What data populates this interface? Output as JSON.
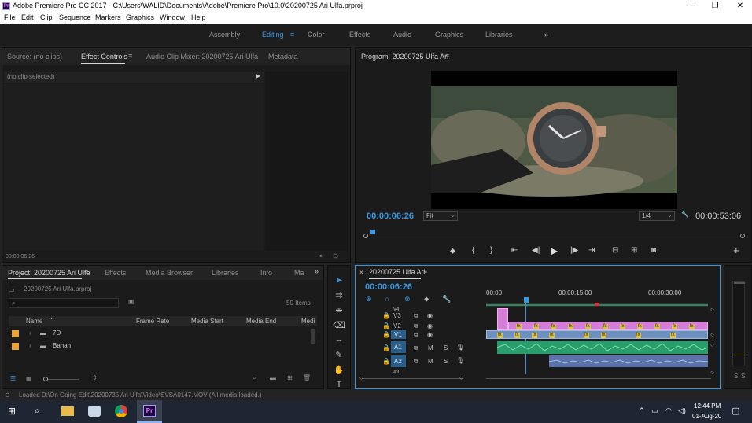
{
  "window": {
    "title": "Adobe Premiere Pro CC 2017 - C:\\Users\\WALID\\Documents\\Adobe\\Premiere Pro\\10.0\\20200725 Ari Ulfa.prproj",
    "app_icon_text": "Pr",
    "minimize": "—",
    "maximize": "❐",
    "close": "✕"
  },
  "menu": [
    "File",
    "Edit",
    "Clip",
    "Sequence",
    "Markers",
    "Graphics",
    "Window",
    "Help"
  ],
  "workspaces": {
    "items": [
      "Assembly",
      "Editing",
      "Color",
      "Effects",
      "Audio",
      "Graphics",
      "Libraries"
    ],
    "active": "Editing",
    "more": "»"
  },
  "source_panel": {
    "tabs": [
      "Source: (no clips)",
      "Effect Controls",
      "Audio Clip Mixer: 20200725 Ari Ulfa",
      "Metadata"
    ],
    "active_tab": "Effect Controls",
    "no_clip": "(no clip selected)",
    "timecode": "00:00:06:26"
  },
  "program_monitor": {
    "title": "Program: 20200725 Ulfa Ari",
    "timecode": "00:00:06:26",
    "fit": "Fit",
    "resolution": "1/4",
    "duration": "00:00:53:06"
  },
  "project_panel": {
    "tabs": [
      "Project: 20200725 Ari Ulfa",
      "Effects",
      "Media Browser",
      "Libraries",
      "Info",
      "Ma"
    ],
    "project_file": "20200725 Ari Ulfa.prproj",
    "items_count": "50 Items",
    "columns": [
      "Name",
      "Frame Rate",
      "Media Start",
      "Media End",
      "Medi"
    ],
    "rows": [
      {
        "name": "7D",
        "color": "#e8a33a"
      },
      {
        "name": "Bahan",
        "color": "#e8a33a"
      }
    ]
  },
  "timeline": {
    "title": "20200725 Ulfa Ari",
    "timecode": "00:00:06:26",
    "ruler": [
      "00:00",
      "00:00:15:00",
      "00:00:30:00"
    ],
    "video_tracks": [
      "V4",
      "V3",
      "V2",
      "V1"
    ],
    "audio_tracks": [
      "A1",
      "A2",
      "A3"
    ],
    "mute": "M",
    "solo": "S"
  },
  "meter": {
    "labels": [
      "S",
      "S"
    ]
  },
  "status_bar": {
    "text": "Loaded D:\\On Going Edit\\20200735 Ari Ulfa\\Video\\SVSA0147.MOV (All media loaded.)"
  },
  "taskbar": {
    "time": "12:44 PM",
    "date": "01-Aug-20"
  },
  "colors": {
    "accent": "#3a98e0",
    "pink_clip": "#d47ed7",
    "blue_clip": "#6e8fbd",
    "green_audio": "#2a9d6d",
    "playhead": "#3a98e0"
  }
}
